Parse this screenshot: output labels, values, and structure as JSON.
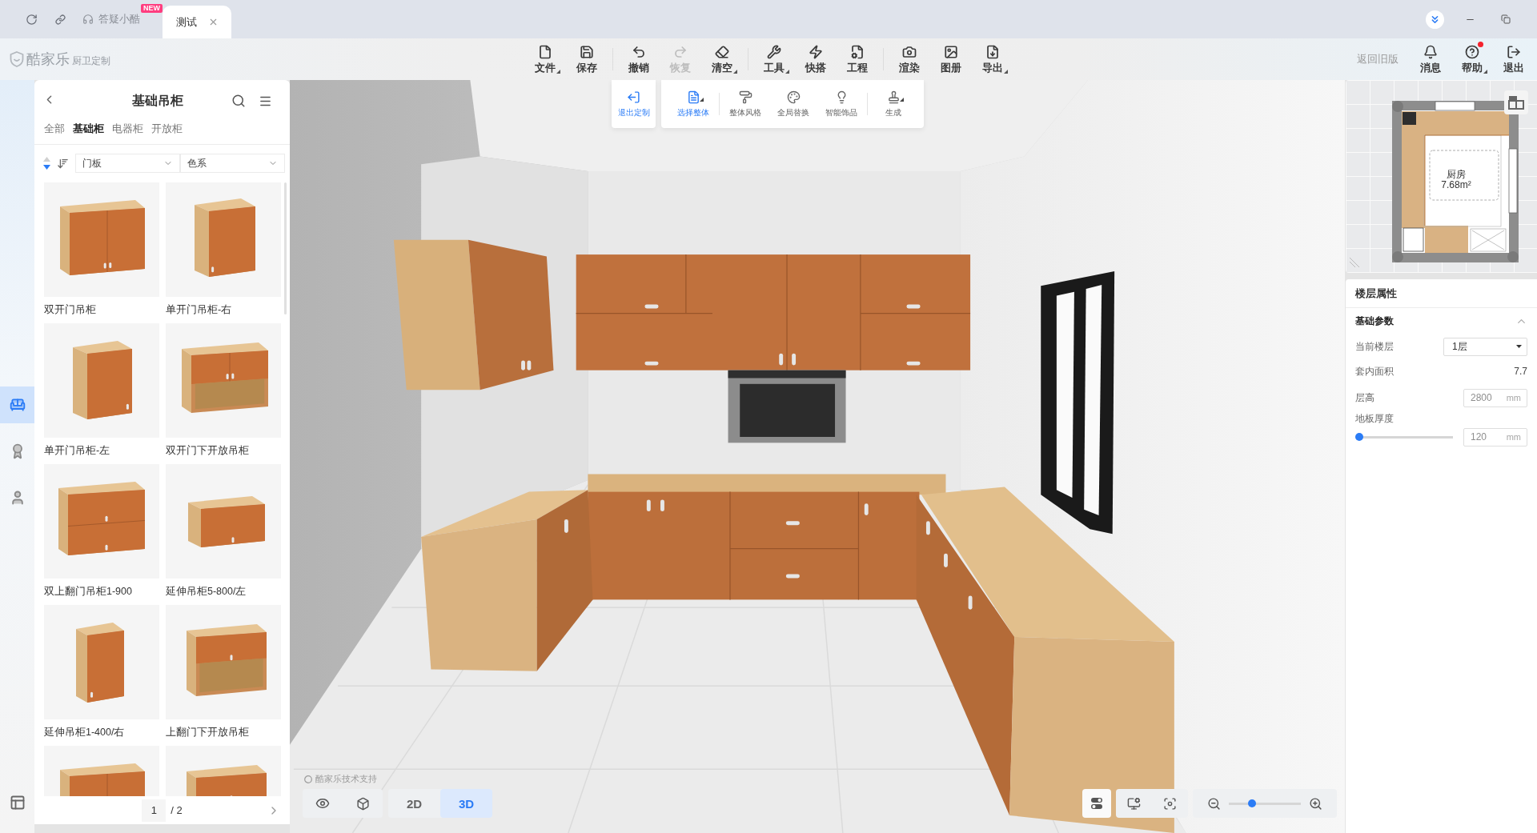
{
  "title_bar": {
    "help": {
      "label": "答疑小酷",
      "badge": "NEW"
    },
    "tabs": [
      {
        "label": "测试",
        "selected": true
      }
    ]
  },
  "logo": {
    "name": "酷家乐",
    "product": "厨卫定制"
  },
  "toolbar": {
    "groups": [
      [
        {
          "label": "文件",
          "menu": true,
          "disabled": false
        },
        {
          "label": "保存",
          "menu": false,
          "disabled": false
        }
      ],
      [
        {
          "label": "撤销",
          "menu": false,
          "disabled": false
        },
        {
          "label": "恢复",
          "menu": false,
          "disabled": true
        },
        {
          "label": "清空",
          "menu": true,
          "disabled": false
        }
      ],
      [
        {
          "label": "工具",
          "menu": true,
          "disabled": false
        },
        {
          "label": "快搭",
          "menu": false,
          "disabled": false
        },
        {
          "label": "工程",
          "menu": false,
          "disabled": false
        }
      ],
      [
        {
          "label": "渲染",
          "menu": false,
          "disabled": false
        },
        {
          "label": "图册",
          "menu": false,
          "disabled": false
        },
        {
          "label": "导出",
          "menu": true,
          "disabled": false
        }
      ]
    ]
  },
  "account": {
    "old_version_link": "返回旧版",
    "actions": [
      {
        "label": "消息",
        "menu": false,
        "notification": false
      },
      {
        "label": "帮助",
        "menu": true,
        "notification": true
      },
      {
        "label": "退出",
        "menu": false,
        "notification": false
      }
    ]
  },
  "side_rail": [
    {
      "selected": true
    },
    {
      "selected": false
    },
    {
      "selected": false
    }
  ],
  "library": {
    "title": "基础吊柜",
    "categories": [
      {
        "label": "全部",
        "selected": false
      },
      {
        "label": "基础柜",
        "selected": true
      },
      {
        "label": "电器柜",
        "selected": false
      },
      {
        "label": "开放柜",
        "selected": false
      }
    ],
    "sort_descending": true,
    "filters": [
      {
        "label": "门板"
      },
      {
        "label": "色系"
      }
    ],
    "products": [
      {
        "name": "双开门吊柜",
        "kind": "double"
      },
      {
        "name": "单开门吊柜-右",
        "kind": "single-right"
      },
      {
        "name": "单开门吊柜-左",
        "kind": "single-left"
      },
      {
        "name": "双开门下开放吊柜",
        "kind": "double-open"
      },
      {
        "name": "双上翻门吊柜1-900",
        "kind": "double-flip"
      },
      {
        "name": "延伸吊柜5-800/左",
        "kind": "extension-left"
      },
      {
        "name": "延伸吊柜1-400/右",
        "kind": "extension-right"
      },
      {
        "name": "上翻门下开放吊柜",
        "kind": "flip-open"
      },
      {
        "kind": "double"
      },
      {
        "kind": "flip-open"
      }
    ],
    "pagination": {
      "page": "1",
      "total": "/ 2"
    }
  },
  "custom_toolbar": {
    "exit": "退出定制",
    "groups": [
      [
        {
          "label": "选择整体",
          "selected": true,
          "menu": true
        }
      ],
      [
        {
          "label": "整体风格",
          "selected": false,
          "menu": false
        },
        {
          "label": "全局替换",
          "selected": false,
          "menu": false
        },
        {
          "label": "智能饰品",
          "selected": false,
          "menu": false
        }
      ],
      [
        {
          "label": "生成",
          "selected": false,
          "menu": true
        }
      ]
    ]
  },
  "canvas": {
    "credit": "酷家乐技术支持",
    "view_modes": [
      {
        "label": "2D",
        "selected": false
      },
      {
        "label": "3D",
        "selected": true
      }
    ],
    "zoom": {
      "level": 0.3
    }
  },
  "minimap": {
    "room_name": "厨房",
    "room_area": "7.68m²"
  },
  "floor_properties": {
    "title": "楼层属性",
    "section": {
      "title": "基础参数",
      "expanded": true
    },
    "rows": [
      {
        "kind": "select",
        "label": "当前楼层",
        "value": "1层"
      },
      {
        "kind": "text",
        "label": "套内面积",
        "value": "7.7"
      },
      {
        "kind": "input",
        "label": "层高",
        "value": "2800",
        "unit": "mm"
      },
      {
        "kind": "slider",
        "label": "地板厚度",
        "level": 0,
        "value": "120",
        "unit": "mm"
      }
    ]
  }
}
